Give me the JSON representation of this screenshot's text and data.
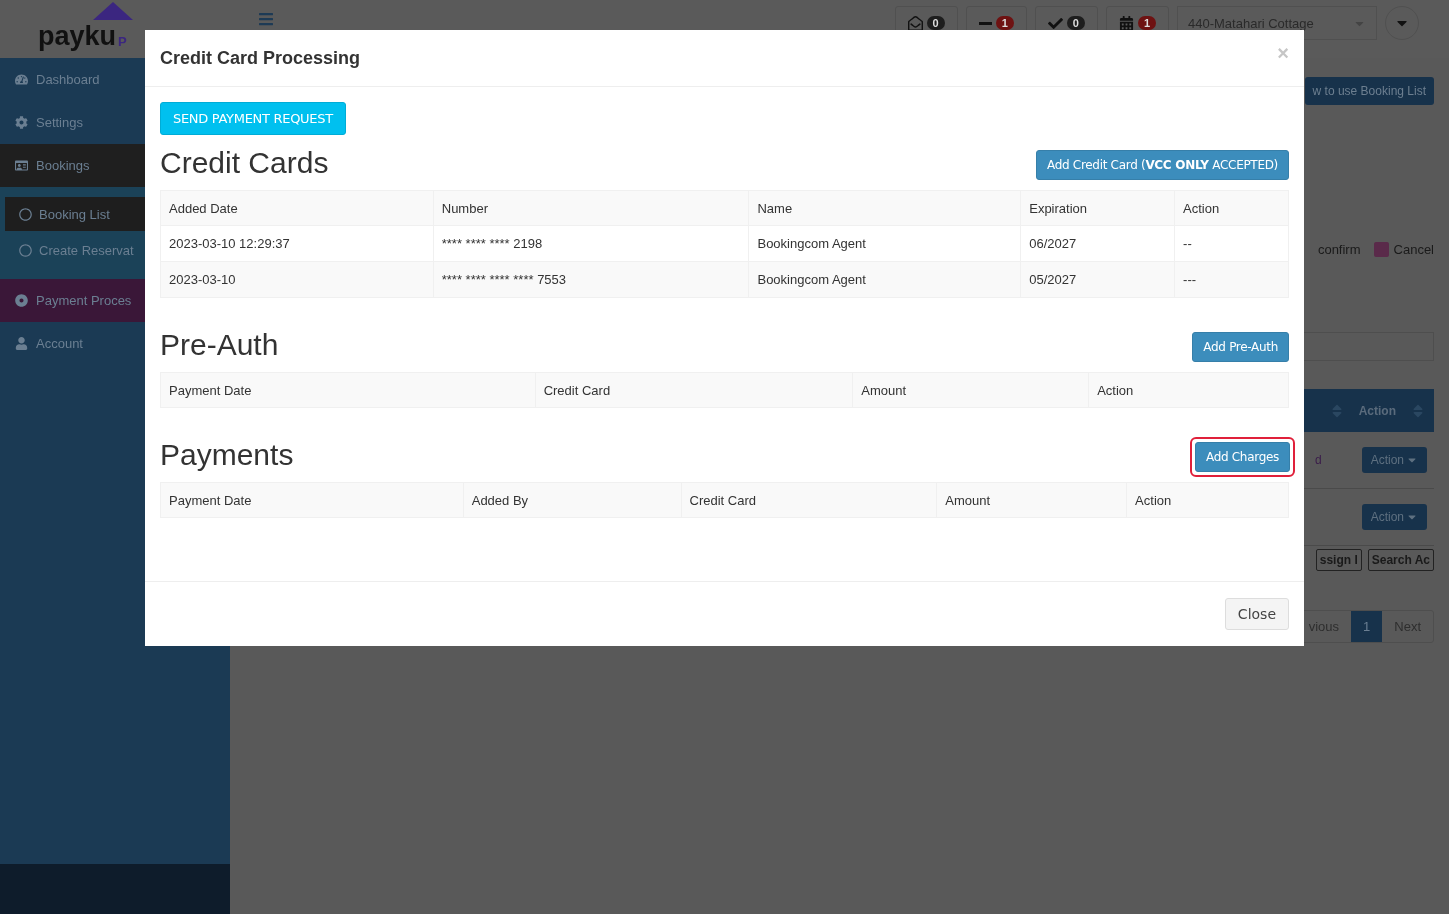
{
  "app": {
    "logo": {
      "text": "payku",
      "suffix": "P"
    },
    "top_bar": {
      "badges": [
        {
          "count": "0",
          "color": "#1e1e1e"
        },
        {
          "count": "1",
          "color": "#6e1212"
        },
        {
          "count": "0",
          "color": "#1e1e1e"
        },
        {
          "count": "1",
          "color": "#6e1212"
        }
      ],
      "property_select": {
        "value": "440-Matahari Cottage"
      }
    },
    "sidebar": {
      "items": [
        {
          "label": "Dashboard",
          "selected": false,
          "expanded": false
        },
        {
          "label": "Settings",
          "selected": false,
          "expanded": false
        },
        {
          "label": "Bookings",
          "selected": false,
          "expanded": true,
          "children": [
            {
              "label": "Booking List",
              "selected": true
            },
            {
              "label": "Create Reservat",
              "selected": false
            }
          ]
        },
        {
          "label": "Payment Proces",
          "selected": true,
          "expanded": false
        },
        {
          "label": "Account",
          "selected": false,
          "expanded": false
        }
      ]
    },
    "content": {
      "help_button": "w to use Booking List",
      "legend": [
        {
          "label": "confirm"
        },
        {
          "label": "Cancel",
          "color": "#5a2a4a"
        }
      ],
      "table_header": "Action",
      "rows": [
        {
          "text": "d",
          "action": "Action"
        },
        {
          "action": "Action"
        }
      ],
      "tool_buttons": [
        "ssign I",
        "Search Ac"
      ],
      "pagination": [
        {
          "label": "vious",
          "selected": false
        },
        {
          "label": "1",
          "selected": true
        },
        {
          "label": "Next",
          "selected": false
        }
      ]
    }
  },
  "modal": {
    "title": "Credit Card Processing",
    "close": "×",
    "send_button": "SEND PAYMENT REQUEST",
    "sections": [
      {
        "title": "Credit Cards",
        "button": "Add Credit Card (**VCC ONLY** ACCEPTED)",
        "highlighted": false,
        "columns": [
          "Added Date",
          "Number",
          "Name",
          "Expiration",
          "Action"
        ],
        "rows": [
          [
            "2023-03-10 12:29:37",
            "**** **** **** 2198",
            "Bookingcom Agent",
            "06/2027",
            "--"
          ],
          [
            "2023-03-10",
            "**** **** **** **** 7553",
            "Bookingcom Agent",
            "05/2027",
            "---"
          ]
        ]
      },
      {
        "title": "Pre-Auth",
        "button": "Add Pre-Auth",
        "highlighted": false,
        "columns": [
          "Payment Date",
          "Credit Card",
          "Amount",
          "Action"
        ]
      },
      {
        "title": "Payments",
        "button": "Add Charges",
        "highlighted": true,
        "columns": [
          "Payment Date",
          "Added By",
          "Credit Card",
          "Amount",
          "Action"
        ]
      }
    ],
    "footer_button": "Close"
  }
}
